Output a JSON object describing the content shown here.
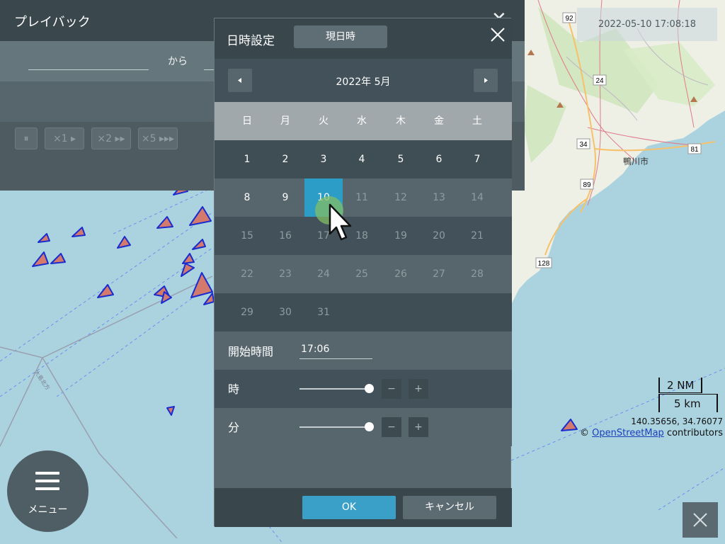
{
  "playback": {
    "title": "プレイバック",
    "from_label": "から",
    "buttons": [
      {
        "label": "⏸"
      },
      {
        "label": "×1 ▸"
      },
      {
        "label": "×2 ▸▸"
      },
      {
        "label": "×5 ▸▸▸"
      }
    ]
  },
  "timestamp": "2022-05-10 17:08:18",
  "map": {
    "place_label": "鴨川市",
    "route_shields": [
      "92",
      "24",
      "34",
      "89",
      "81",
      "128"
    ],
    "scale_nm": "2 NM",
    "scale_km": "5 km",
    "coords": "140.35656, 34.76077",
    "attribution_prefix": "© ",
    "attribution_link": "OpenStreetMap",
    "attribution_suffix": " contributors",
    "land_color": "#eef0e6",
    "sea_color": "#aad3df",
    "vessel_fill": "#d47a6c",
    "vessel_stroke": "#1a2bcf"
  },
  "menu": {
    "label": "メニュー"
  },
  "dialog": {
    "title": "日時設定",
    "now_button": "現日時",
    "month_label": "2022年 5月",
    "weekdays": [
      "日",
      "月",
      "火",
      "水",
      "木",
      "金",
      "土"
    ],
    "weeks": [
      [
        "1",
        "2",
        "3",
        "4",
        "5",
        "6",
        "7"
      ],
      [
        "8",
        "9",
        "10",
        "11",
        "12",
        "13",
        "14"
      ],
      [
        "15",
        "16",
        "17",
        "18",
        "19",
        "20",
        "21"
      ],
      [
        "22",
        "23",
        "24",
        "25",
        "26",
        "27",
        "28"
      ],
      [
        "29",
        "30",
        "31",
        "",
        "",
        "",
        ""
      ]
    ],
    "selected_day": "10",
    "start_time_label": "開始時間",
    "start_time_value": "17:06",
    "hour_label": "時",
    "minute_label": "分",
    "hour_slider_fraction": 1.0,
    "minute_slider_fraction": 1.0,
    "minus": "−",
    "plus": "+",
    "ok": "OK",
    "cancel": "キャンセル",
    "accent_color": "#2c9dc6"
  }
}
